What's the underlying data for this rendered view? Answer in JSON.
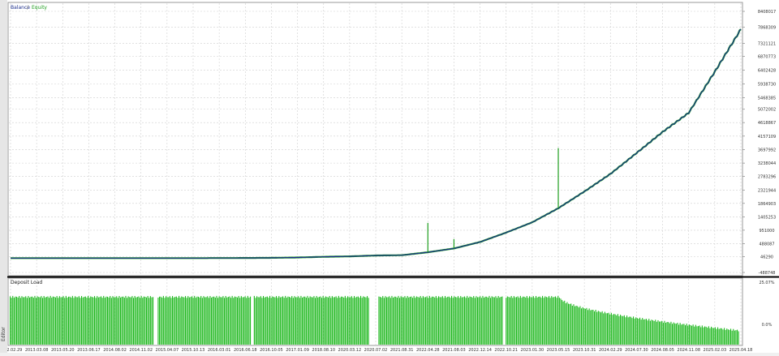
{
  "side_tab": {
    "label": "Editor"
  },
  "legend": {
    "balance": "Balance",
    "equity": "Equity"
  },
  "colors": {
    "balance": "#1a2d8c",
    "equity": "#1f9e1f",
    "deposit": "#1fb81f",
    "grid": "#cfcfcf",
    "separator": "#000000"
  },
  "chart_data": [
    {
      "type": "line",
      "title": "",
      "series": [
        {
          "name": "Balance",
          "color": "#1a2d8c"
        },
        {
          "name": "Equity",
          "color": "#1f9e1f"
        }
      ],
      "x": [
        "2012.02.29",
        "2013.03.08",
        "2013.05.20",
        "2013.06.17",
        "2014.08.02",
        "2014.11.02",
        "2015.04.07",
        "2015.10.13",
        "2016.03.01",
        "2016.06.18",
        "2016.10.05",
        "2017.01.09",
        "2018.08.10",
        "2020.03.12",
        "2020.07.02",
        "2021.08.31",
        "2022.04.28",
        "2021.08.03",
        "2022.12.14",
        "2022.10.21",
        "2023.01.30",
        "2023.05.15",
        "2023.10.31",
        "2024.02.29",
        "2024.07.30",
        "2024.08.05",
        "2024.11.08",
        "2025.02.03",
        "2025.04.18"
      ],
      "y_ticks": [
        "-488748",
        "46290",
        "488087",
        "951000",
        "1405253",
        "1864903",
        "2321944",
        "2783296",
        "3238044",
        "3697992",
        "4157109",
        "4618867",
        "5072002",
        "5468385",
        "5938730",
        "6402428",
        "6870773",
        "7321121",
        "7868309",
        "8408017"
      ],
      "y_range": [
        -488748,
        8408017
      ],
      "balance_values": [
        0,
        0,
        0,
        0,
        0,
        0,
        0,
        0,
        3000,
        5000,
        10000,
        22000,
        45000,
        60000,
        90000,
        100000,
        200000,
        330000,
        550000,
        870000,
        1220000,
        1700000,
        2270000,
        2870000,
        3580000,
        4300000,
        4950000,
        6350000,
        7800000
      ],
      "equity_dips": [
        {
          "x": "2023.05.15",
          "value": 3750000
        },
        {
          "x": "2022.04.28",
          "value": 1200000
        },
        {
          "x": "2021.08.03",
          "value": 650000
        }
      ]
    },
    {
      "type": "bar",
      "title": "Deposit Load",
      "y_ticks": [
        "25.07%",
        "0.0%"
      ],
      "y_range": [
        0,
        25.07
      ],
      "series": [
        {
          "name": "Deposit Load",
          "color": "#1fb81f"
        }
      ],
      "summary": {
        "plateau_value": 20.5,
        "end_value": 1.3
      }
    }
  ]
}
